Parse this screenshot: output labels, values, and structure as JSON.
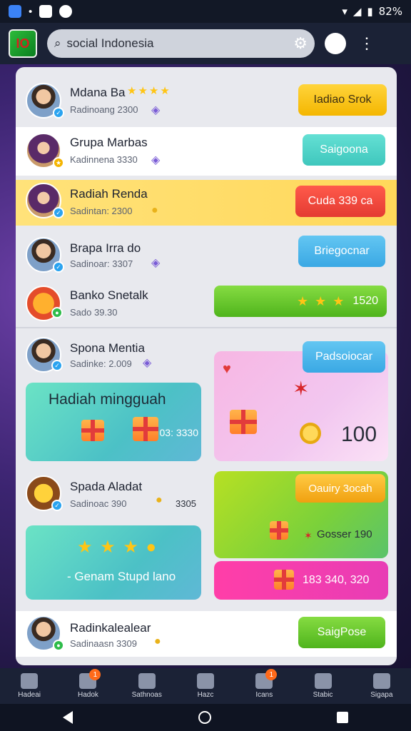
{
  "status": {
    "battery": "82%"
  },
  "topbar": {
    "search_text": "social Indonesia"
  },
  "rows": [
    {
      "name": "Mdana Ba",
      "sub": "Radinoang 2300",
      "button": "Iadiao Srok"
    },
    {
      "name": "Grupa Marbas",
      "sub": "Kadinnena 3330",
      "button": "Saigoona"
    },
    {
      "name": "Radiah Renda",
      "sub": "Sadintan: 2300",
      "button": "Cuda 339 ca"
    },
    {
      "name": "Brapa Irra do",
      "sub": "Sadinoar: 3307",
      "button": "Briegocnar"
    },
    {
      "name": "Banko Snetalk",
      "sub": "Sado 39.30",
      "button": "1520"
    },
    {
      "name": "Spona Mentia",
      "sub": "Sadinke: 2.009",
      "button": "Padsoiocar"
    },
    {
      "name": "Spada Aladat",
      "sub": "Sadinoac 390",
      "value": "3305"
    },
    {
      "name": "Radinkalealear",
      "sub": "Sadinaasn 3309",
      "button": "SaigPose"
    }
  ],
  "cards": {
    "weekly_title": "Hadiah mingguah",
    "weekly_line": "03: 3330",
    "pink_value": "100",
    "orange_button": "Oauiry 3ocah",
    "lime_line": "Gosser 190",
    "magenta_line": "183 340, 320",
    "teal2_line": "- Genam Stupd lano"
  },
  "bottom_nav": [
    {
      "label": "Hadeai"
    },
    {
      "label": "Hadok",
      "badge": "1"
    },
    {
      "label": "Sathnoas"
    },
    {
      "label": "Hazc"
    },
    {
      "label": "Icans",
      "badge": "1"
    },
    {
      "label": "Stabic"
    },
    {
      "label": "Sigapa"
    }
  ]
}
